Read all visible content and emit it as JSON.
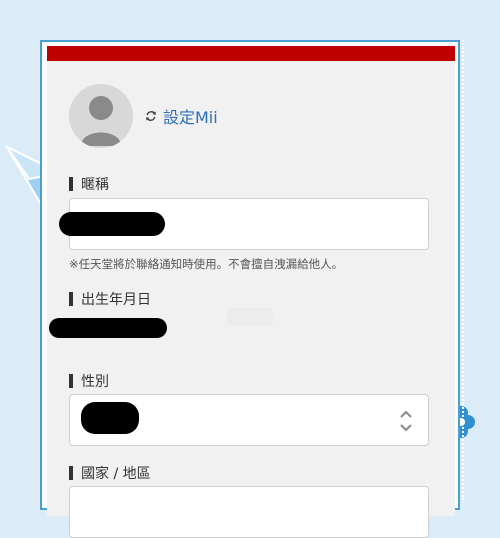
{
  "mii": {
    "link_label": "設定Mii"
  },
  "nickname": {
    "label": "暱稱",
    "note": "※任天堂將於聯絡通知時使用。不會擅自洩漏給他人。"
  },
  "birthdate": {
    "label": "出生年月日"
  },
  "gender": {
    "label": "性別"
  },
  "region": {
    "label": "國家 / 地區"
  },
  "colors": {
    "topbar": "#c00000",
    "link": "#2f6fb3",
    "background": "#dcebf8",
    "frame": "#4a9fd0"
  }
}
